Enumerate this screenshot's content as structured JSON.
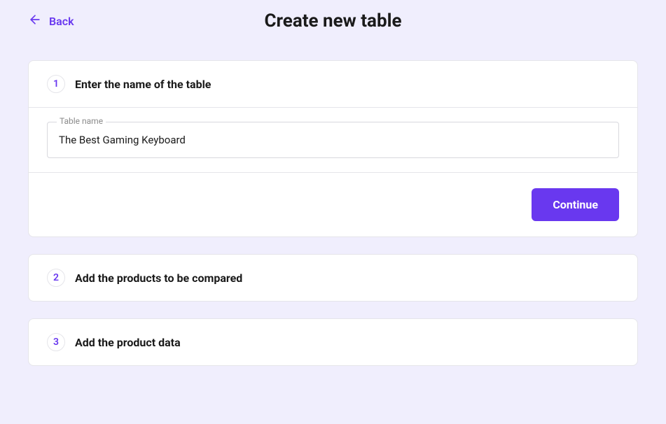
{
  "header": {
    "back_label": "Back",
    "page_title": "Create new table"
  },
  "steps": [
    {
      "number": "1",
      "title": "Enter the name of the table",
      "field_label": "Table name",
      "field_value": "The Best Gaming Keyboard",
      "continue_label": "Continue"
    },
    {
      "number": "2",
      "title": "Add the products to be compared"
    },
    {
      "number": "3",
      "title": "Add the product data"
    }
  ],
  "colors": {
    "accent": "#6938ef",
    "background": "#f0eefd"
  }
}
